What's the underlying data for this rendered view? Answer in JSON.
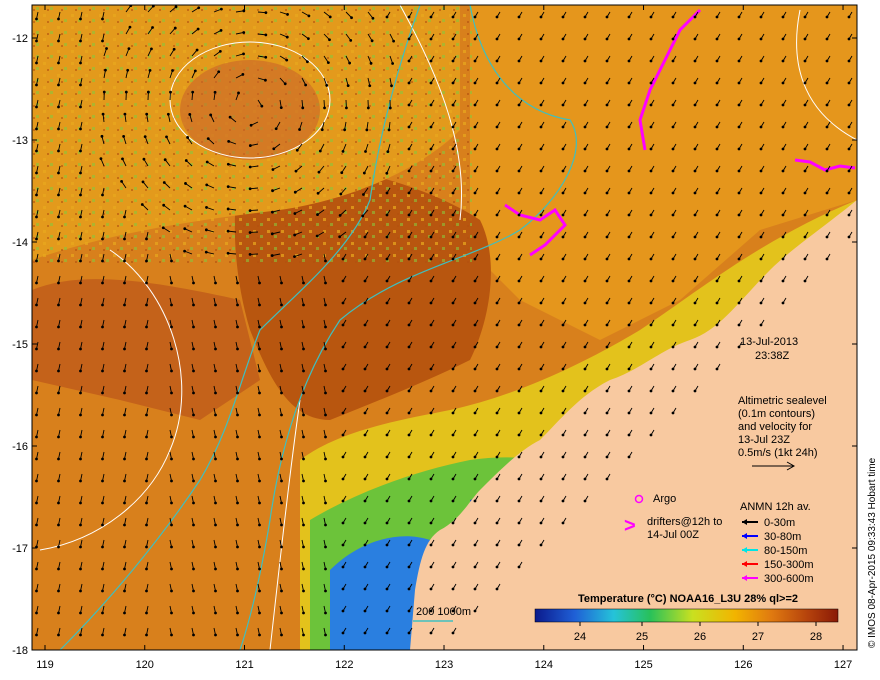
{
  "map": {
    "date": "13-Jul-2013",
    "time": "23:38Z",
    "info_lines": [
      "Altimetric sealevel",
      "(0.1m contours)",
      "and velocity for",
      "13-Jul 23Z",
      "0.5m/s (1kt 24h)"
    ],
    "argo_label": "Argo",
    "drifters_lines": [
      "drifters@12h to",
      "14-Jul 00Z"
    ],
    "anmn_title": "ANMN 12h av.",
    "anmn_legend": [
      {
        "label": "0-30m",
        "color": "#000000"
      },
      {
        "label": "30-80m",
        "color": "#0000ff"
      },
      {
        "label": "80-150m",
        "color": "#00e5e5"
      },
      {
        "label": "150-300m",
        "color": "#ff0000"
      },
      {
        "label": "300-600m",
        "color": "#ff00ff"
      }
    ],
    "isobath_label": "200  1000m",
    "colorbar": {
      "title": "Temperature (°C) NOAA16_L3U 28% ql>=2",
      "ticks": [
        "24",
        "25",
        "26",
        "27",
        "28"
      ],
      "stops": [
        "#0b1a8c",
        "#1f5fd6",
        "#25c3d9",
        "#28c15a",
        "#c9e020",
        "#f2b400",
        "#e07a10",
        "#b5420c",
        "#8a1a06"
      ]
    },
    "credit": "© IMOS 08-Apr-2015 09:33:43 Hobart time",
    "lon_ticks": [
      "119",
      "120",
      "121",
      "122",
      "123",
      "124",
      "125",
      "126",
      "127"
    ],
    "lat_ticks": [
      "-12",
      "-13",
      "-14",
      "-15",
      "-16",
      "-17",
      "-18"
    ],
    "colors": {
      "land": "#f8c9a0",
      "sea_warm": "#d2731a",
      "sea_hot": "#b3500f",
      "sea_mid": "#e7a11d",
      "sea_green": "#6cc33a",
      "sea_blue": "#1a4fcf",
      "isobath": "#3fbfbf",
      "drifter": "#ff00ff",
      "contour": "#ffffff"
    }
  }
}
